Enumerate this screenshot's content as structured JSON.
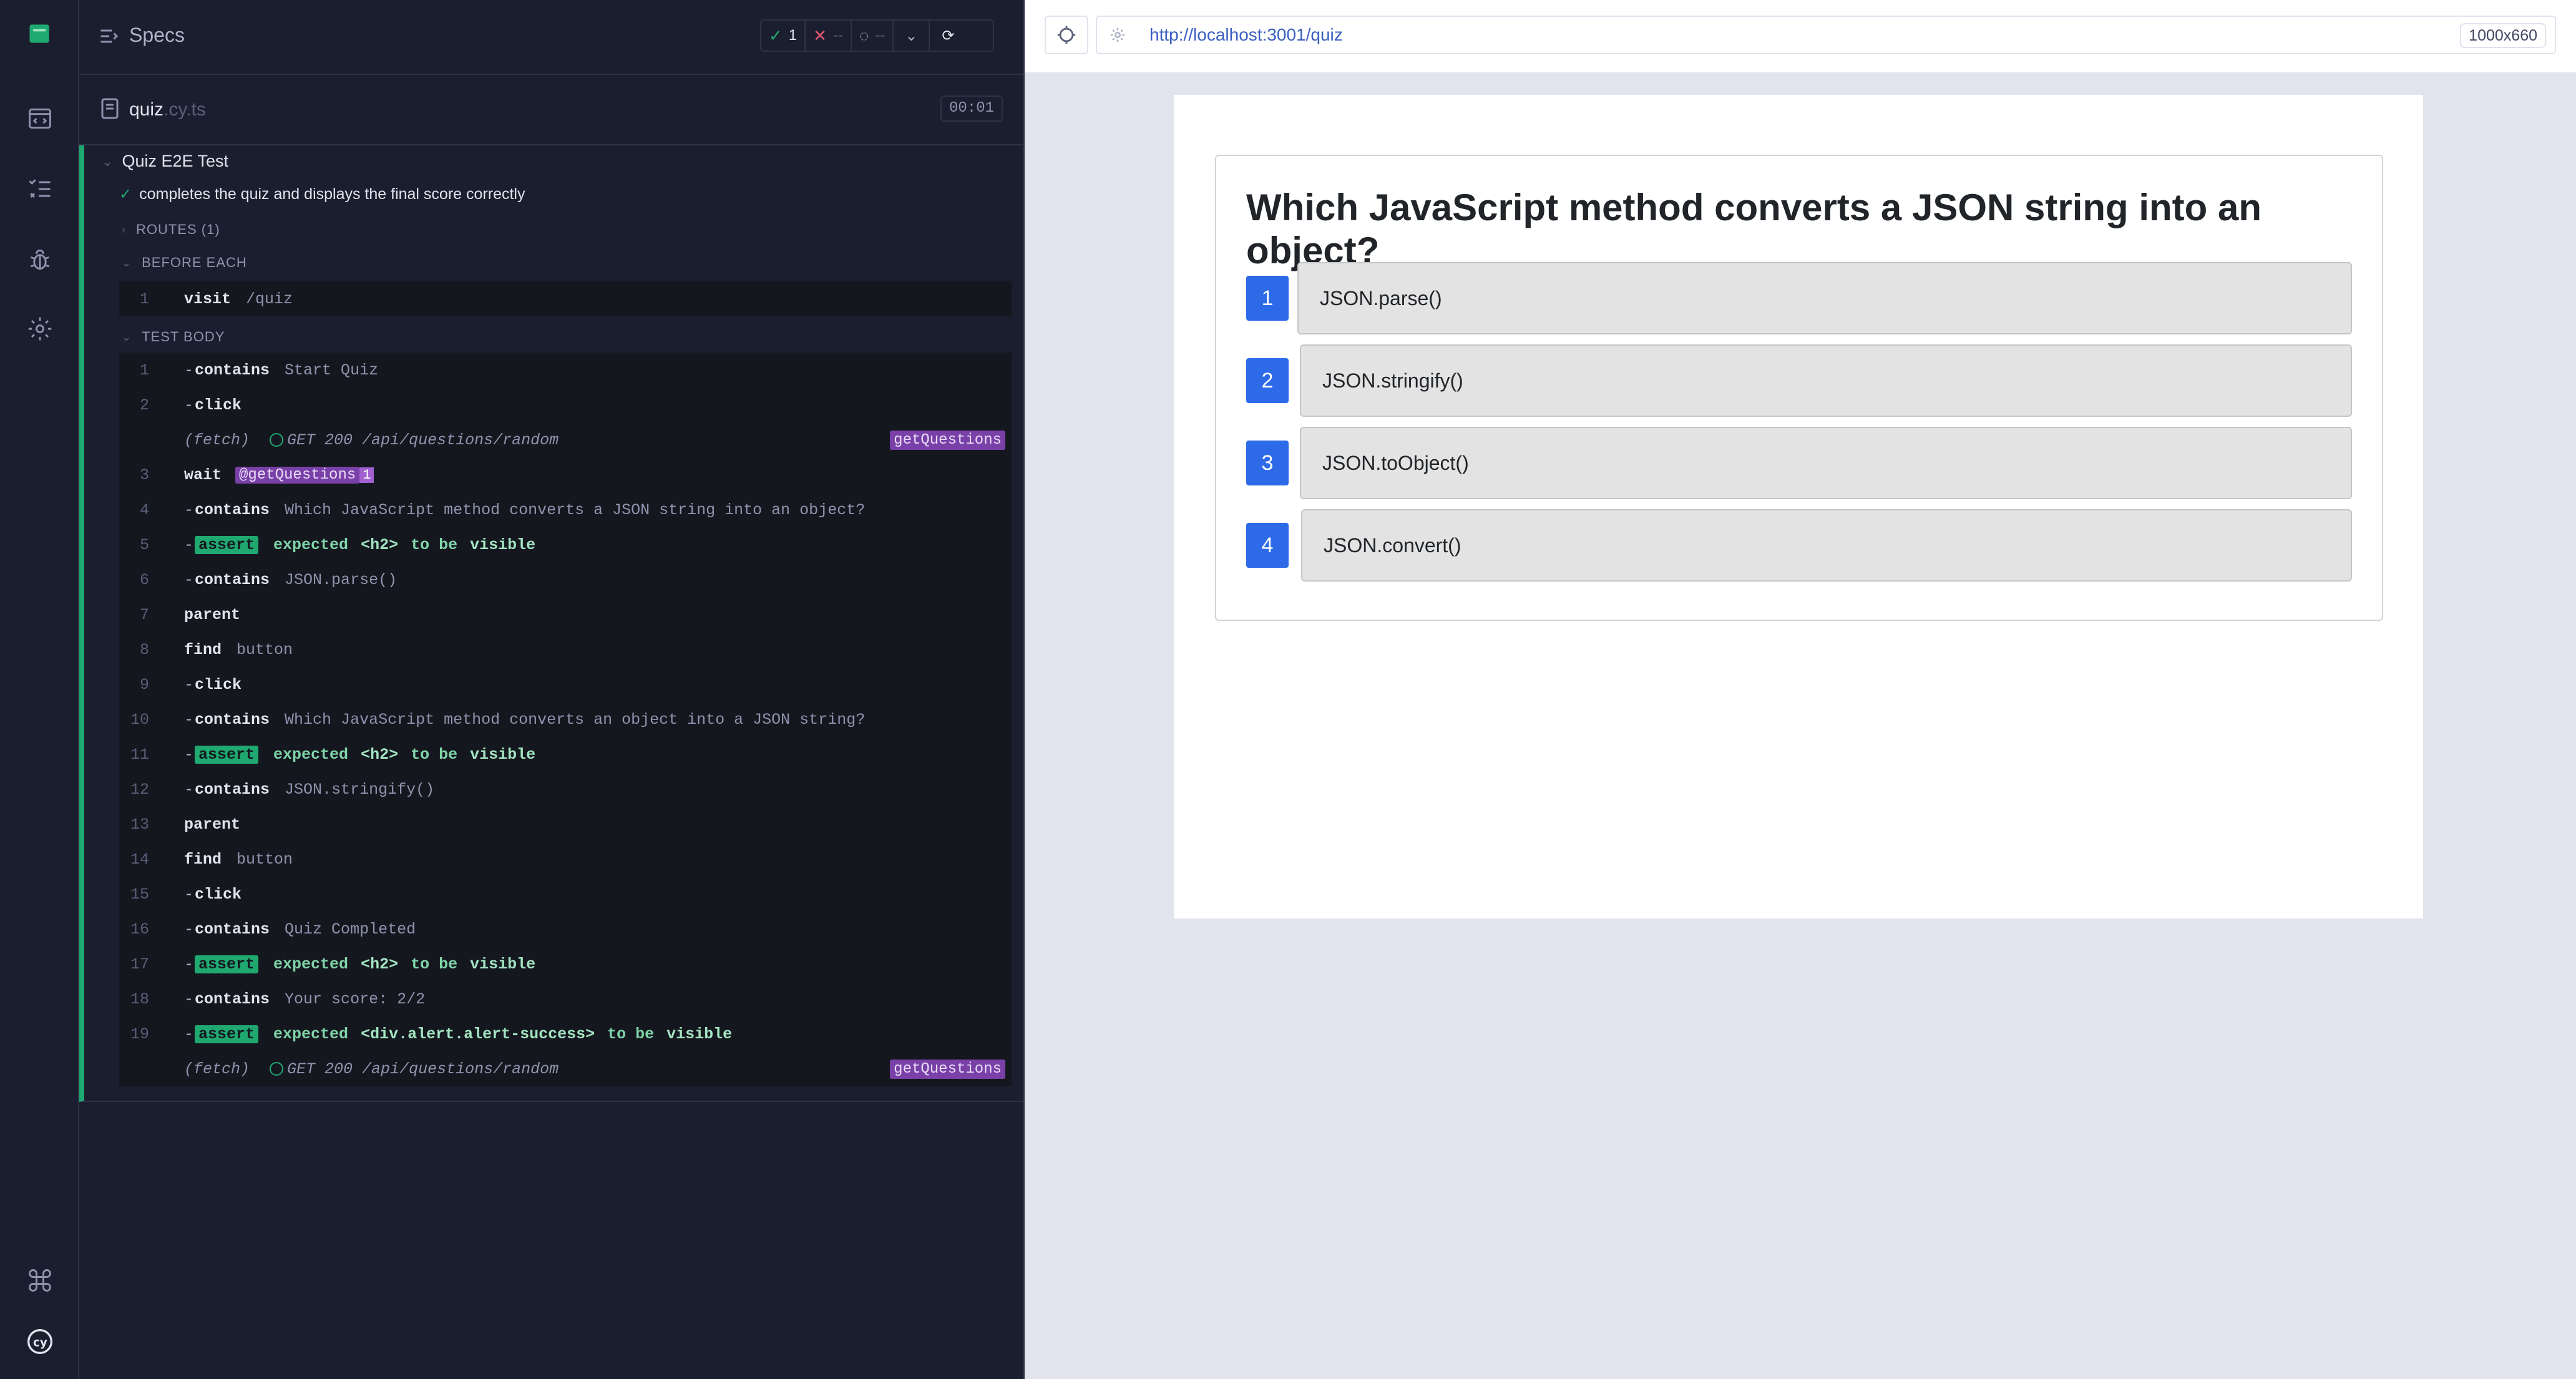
{
  "reporter": {
    "header": {
      "title": "Specs"
    },
    "stats": {
      "passed": "1",
      "failed": "--",
      "pending": "--"
    },
    "spec": {
      "name": "quiz",
      "ext": ".cy.ts",
      "duration": "00:01"
    },
    "suite": "Quiz E2E Test",
    "test": "completes the quiz and displays the final score correctly",
    "routes": "ROUTES (1)",
    "before_each": "BEFORE EACH",
    "before_cmds": [
      {
        "num": "1",
        "name": "visit",
        "arg": "/quiz"
      }
    ],
    "test_body": "TEST BODY",
    "cmds": [
      {
        "num": "1",
        "name": "contains",
        "arg": "Start Quiz"
      },
      {
        "num": "2",
        "name": "click",
        "arg": ""
      },
      {
        "num": "",
        "fetch": "(fetch)",
        "route": "GET 200 /api/questions/random",
        "alias": "getQuestions"
      },
      {
        "num": "3",
        "name": "wait",
        "alias": "@getQuestions",
        "count": "1"
      },
      {
        "num": "4",
        "name": "contains",
        "arg": "Which JavaScript method converts a JSON string into an object?"
      },
      {
        "num": "5",
        "assert": "assert",
        "expected": "expected",
        "subject": "<h2>",
        "tobe": "to be",
        "value": "visible"
      },
      {
        "num": "6",
        "name": "contains",
        "arg": "JSON.parse()"
      },
      {
        "num": "7",
        "name": "parent",
        "arg": ""
      },
      {
        "num": "8",
        "name": "find",
        "arg": "button"
      },
      {
        "num": "9",
        "name": "click",
        "arg": ""
      },
      {
        "num": "10",
        "name": "contains",
        "arg": "Which JavaScript method converts an object into a JSON string?"
      },
      {
        "num": "11",
        "assert": "assert",
        "expected": "expected",
        "subject": "<h2>",
        "tobe": "to be",
        "value": "visible"
      },
      {
        "num": "12",
        "name": "contains",
        "arg": "JSON.stringify()"
      },
      {
        "num": "13",
        "name": "parent",
        "arg": ""
      },
      {
        "num": "14",
        "name": "find",
        "arg": "button"
      },
      {
        "num": "15",
        "name": "click",
        "arg": ""
      },
      {
        "num": "16",
        "name": "contains",
        "arg": "Quiz Completed"
      },
      {
        "num": "17",
        "assert": "assert",
        "expected": "expected",
        "subject": "<h2>",
        "tobe": "to be",
        "value": "visible"
      },
      {
        "num": "18",
        "name": "contains",
        "arg": "Your score: 2/2"
      },
      {
        "num": "19",
        "assert": "assert",
        "expected": "expected",
        "subject": "<div.alert.alert-success>",
        "tobe": "to be",
        "value": "visible"
      },
      {
        "num": "",
        "fetch": "(fetch)",
        "route": "GET 200 /api/questions/random",
        "alias": "getQuestions"
      }
    ]
  },
  "browser": {
    "url": "http://localhost:3001/quiz",
    "viewport": "1000x660",
    "question": "Which JavaScript method converts a JSON string into an object?",
    "options": [
      {
        "num": "1",
        "label": "JSON.parse()"
      },
      {
        "num": "2",
        "label": "JSON.stringify()"
      },
      {
        "num": "3",
        "label": "JSON.toObject()"
      },
      {
        "num": "4",
        "label": "JSON.convert()"
      }
    ]
  },
  "colors": {
    "accent_pass": "#1fa971",
    "alias": "#7940a8",
    "option_badge": "#2d6ae8"
  },
  "icons": [
    "app-logo-icon",
    "specs-nav-icon",
    "runs-nav-icon",
    "debug-nav-icon",
    "settings-nav-icon",
    "keyboard-shortcuts-icon",
    "cypress-logo-icon",
    "selector-playground-icon",
    "settings-gear-icon"
  ]
}
